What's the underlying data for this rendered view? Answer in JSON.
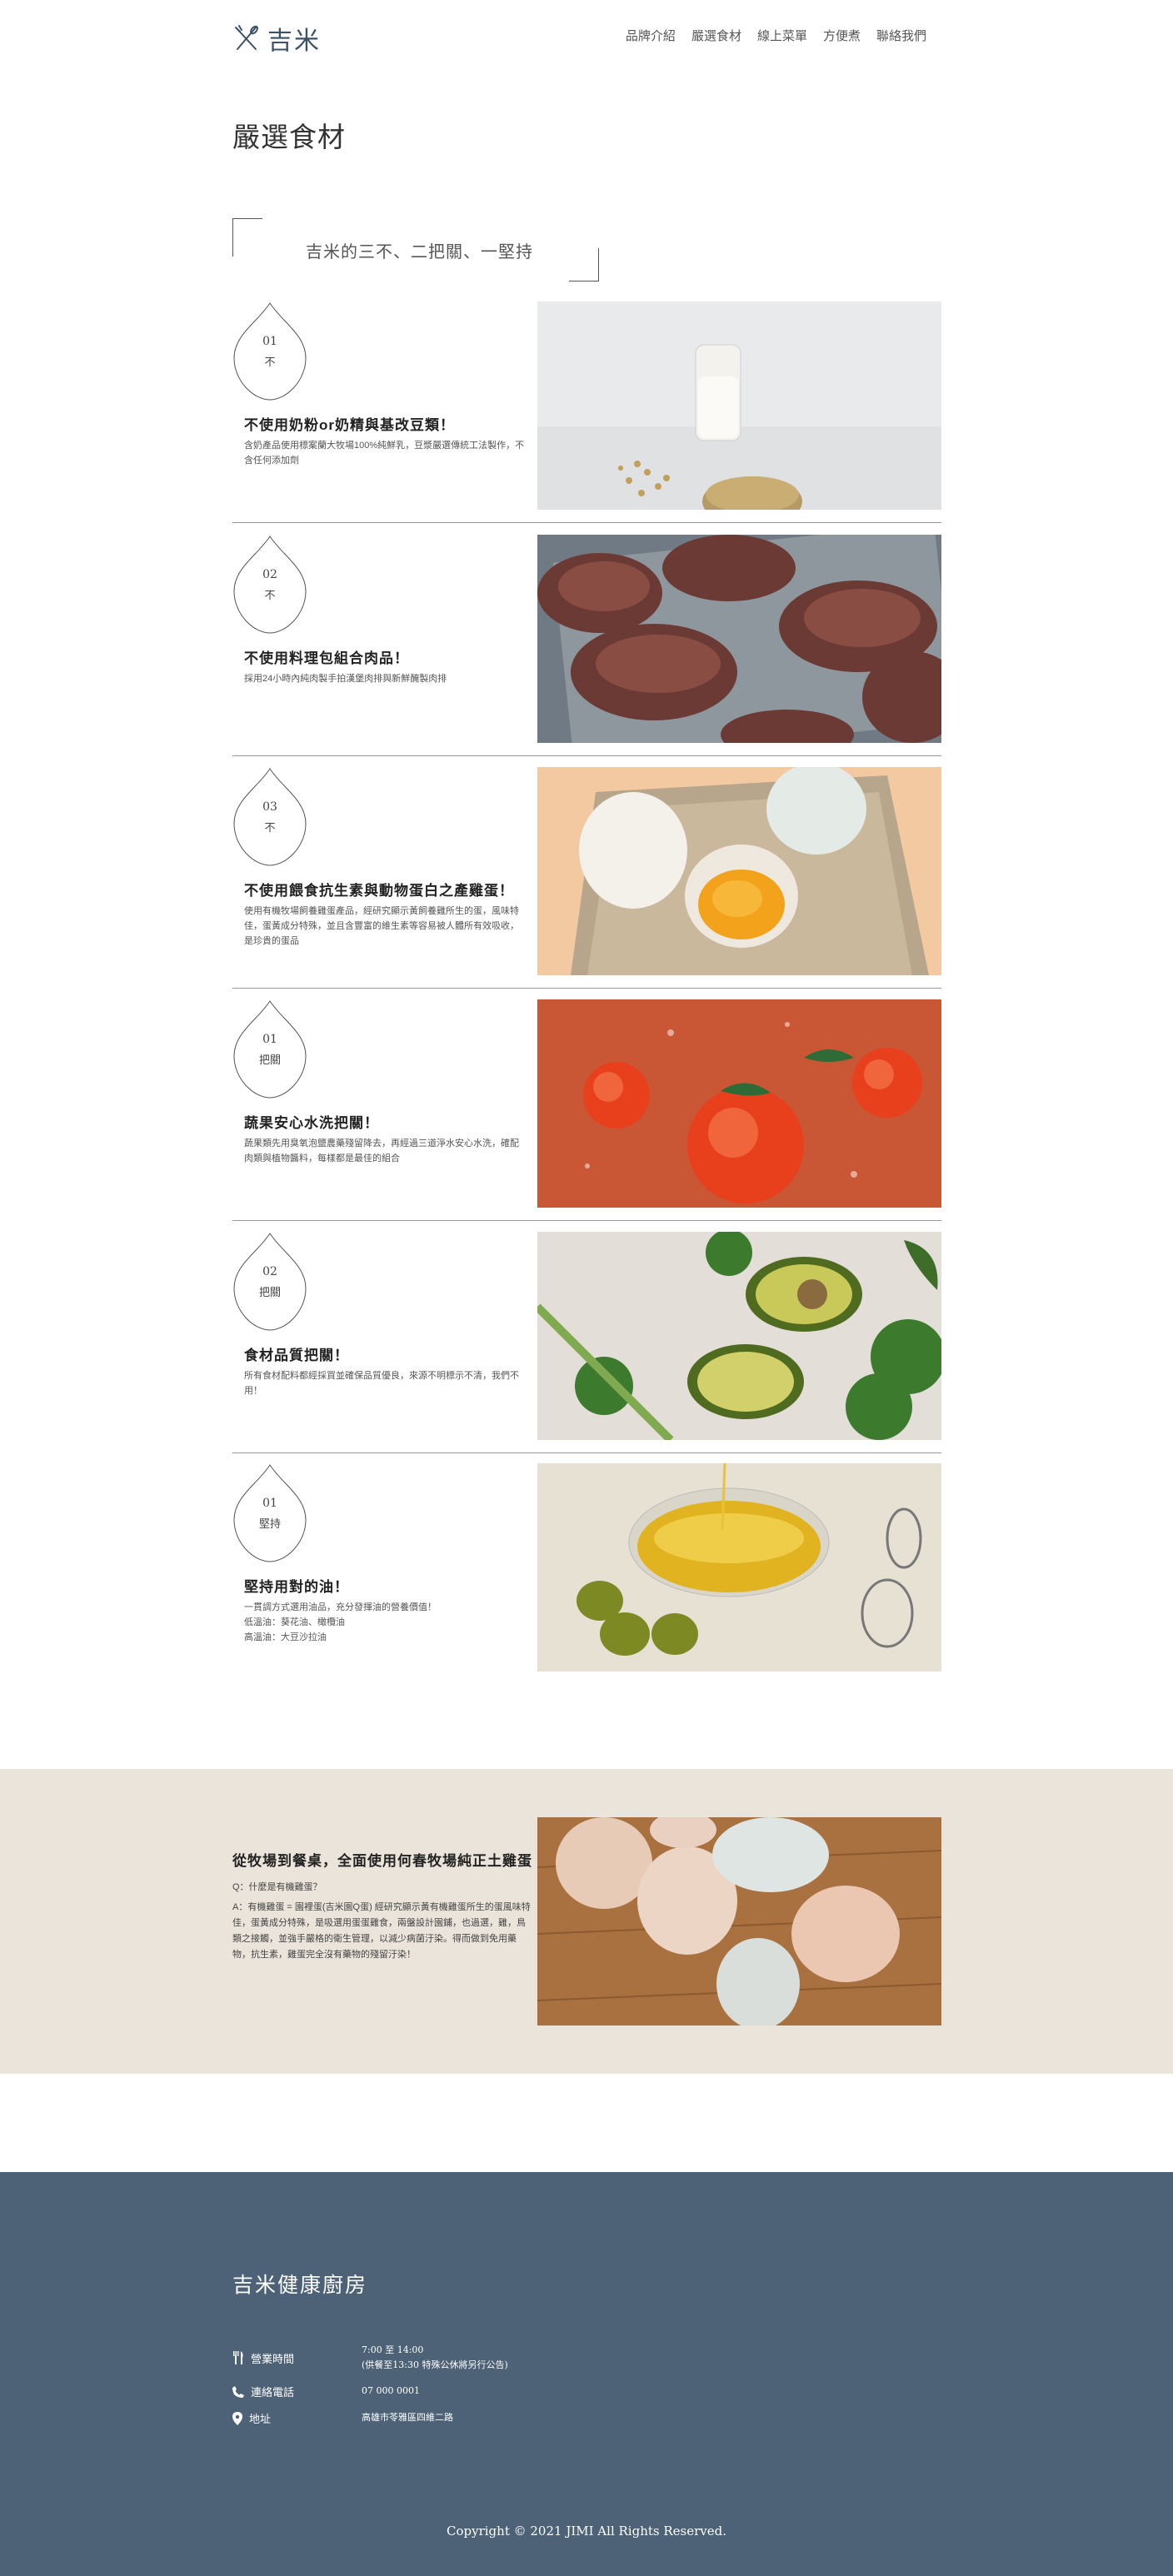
{
  "header": {
    "logo_text": "吉米",
    "nav": [
      "品牌介紹",
      "嚴選食材",
      "線上菜單",
      "方便煮",
      "聯絡我們"
    ]
  },
  "page_title": "嚴選食材",
  "subtitle": "吉米的三不、二把關、一堅持",
  "items": [
    {
      "num": "01",
      "kind": "不",
      "title": "不使用奶粉or奶精與基改豆類！",
      "desc": "含奶產品使用標案蘭大牧場100%純鮮乳，豆漿嚴選傳統工法製作，不含任何添加劑",
      "image": "milk-and-soybeans"
    },
    {
      "num": "02",
      "kind": "不",
      "title": "不使用料理包組合肉品！",
      "desc": "採用24小時內純肉製手拍漢堡肉排與新鮮醃製肉排",
      "image": "burger-patties"
    },
    {
      "num": "03",
      "kind": "不",
      "title": "不使用餵食抗生素與動物蛋白之產雞蛋！",
      "desc": "使用有機牧場飼養雞蛋產品，經研究顯示黃飼養雞所生的蛋，風味特佳，蛋黃成分特殊，並且含豐富的維生素等容易被人體所有效吸收，是珍貴的蛋品",
      "image": "eggs-in-carton"
    },
    {
      "num": "01",
      "kind": "把關",
      "title": "蔬果安心水洗把關！",
      "desc": "蔬果類先用臭氧泡鹽農藥殘留降去，再經過三道淨水安心水洗，確配肉類與植物醬料，每樣都是最佳的組合",
      "image": "tomatoes-in-water"
    },
    {
      "num": "02",
      "kind": "把關",
      "title": "食材品質把關！",
      "desc": "所有食材配料都經採買並確保品質優良，來源不明標示不清，我們不用！",
      "image": "vegetables-avocado"
    },
    {
      "num": "01",
      "kind": "堅持",
      "title": "堅持用對的油！",
      "desc_lines": [
        "一貫調方式選用油品，充分發揮油的營養價值！",
        "低溫油：葵花油、橄欖油",
        "高溫油：大豆沙拉油"
      ],
      "image": "olive-oil"
    }
  ],
  "egg_section": {
    "title": "從牧場到餐桌，全面使用何春牧場純正土雞蛋",
    "question": "Q：什麼是有機雞蛋？",
    "answer": "A：有機雞蛋 = 園裡蛋(吉米園Q蛋) 經研究顯示黃有機雞蛋所生的蛋風味特佳，蛋黃成分特殊，是吸選用蛋蛋雞食，兩盤設計園鋪，也過選，雞，鳥類之接觸，並強手嚴格的衛生管理，以減少病菌汙染。得而做到免用藥物，抗生素，雞蛋完全沒有藥物的殘留汙染！",
    "image": "brown-and-white-eggs"
  },
  "footer": {
    "brand": "吉米健康廚房",
    "hours_label": "營業時間",
    "hours_value": [
      "7:00 至 14:00",
      "(供餐至13:30 特殊公休將另行公告)"
    ],
    "phone_label": "連絡電話",
    "phone_value": "07 000 0001",
    "address_label": "地址",
    "address_value": "高雄市苓雅區四維二路",
    "copyright": "Copyright © 2021 JIMI All Rights Reserved."
  },
  "colors": {
    "footer_bg": "#4d6277",
    "egg_band_bg": "#ebe4db",
    "logo": "#3c5269"
  }
}
